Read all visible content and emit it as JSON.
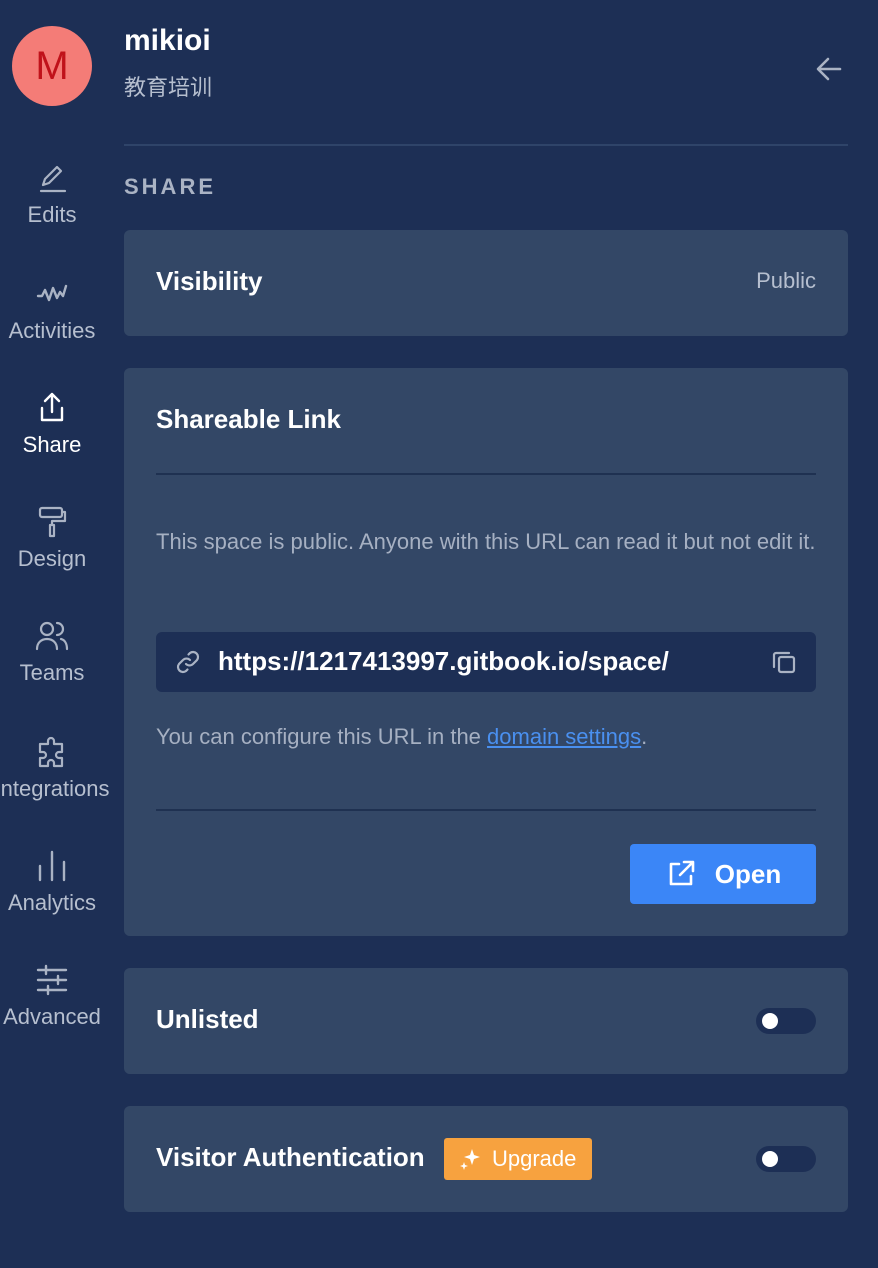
{
  "header": {
    "avatar_letter": "M",
    "space_name": "mikioi",
    "space_subtitle": "教育培训"
  },
  "nav": {
    "items": [
      {
        "label": "Edits",
        "icon": "pencil-icon",
        "active": false
      },
      {
        "label": "Activities",
        "icon": "activity-icon",
        "active": false
      },
      {
        "label": "Share",
        "icon": "share-icon",
        "active": true
      },
      {
        "label": "Design",
        "icon": "paint-roller-icon",
        "active": false
      },
      {
        "label": "Teams",
        "icon": "users-icon",
        "active": false
      },
      {
        "label": "Integrations",
        "icon": "puzzle-icon",
        "active": false
      },
      {
        "label": "Analytics",
        "icon": "bar-chart-icon",
        "active": false
      },
      {
        "label": "Advanced",
        "icon": "sliders-icon",
        "active": false
      }
    ]
  },
  "section": {
    "title": "SHARE"
  },
  "visibility": {
    "title": "Visibility",
    "value": "Public"
  },
  "shareable": {
    "title": "Shareable Link",
    "description": "This space is public. Anyone with this URL can read it but not edit it.",
    "url": "https://1217413997.gitbook.io/space/",
    "hint_prefix": "You can configure this URL in the ",
    "hint_link": "domain settings",
    "hint_suffix": ".",
    "open_label": "Open"
  },
  "unlisted": {
    "title": "Unlisted",
    "enabled": false
  },
  "visitor_auth": {
    "title": "Visitor Authentication",
    "badge_label": "Upgrade",
    "enabled": false
  },
  "colors": {
    "background": "#1d2f55",
    "card": "#334766",
    "accent": "#3b86f7",
    "upgrade": "#f7a23f",
    "avatar": "#f47c77"
  }
}
